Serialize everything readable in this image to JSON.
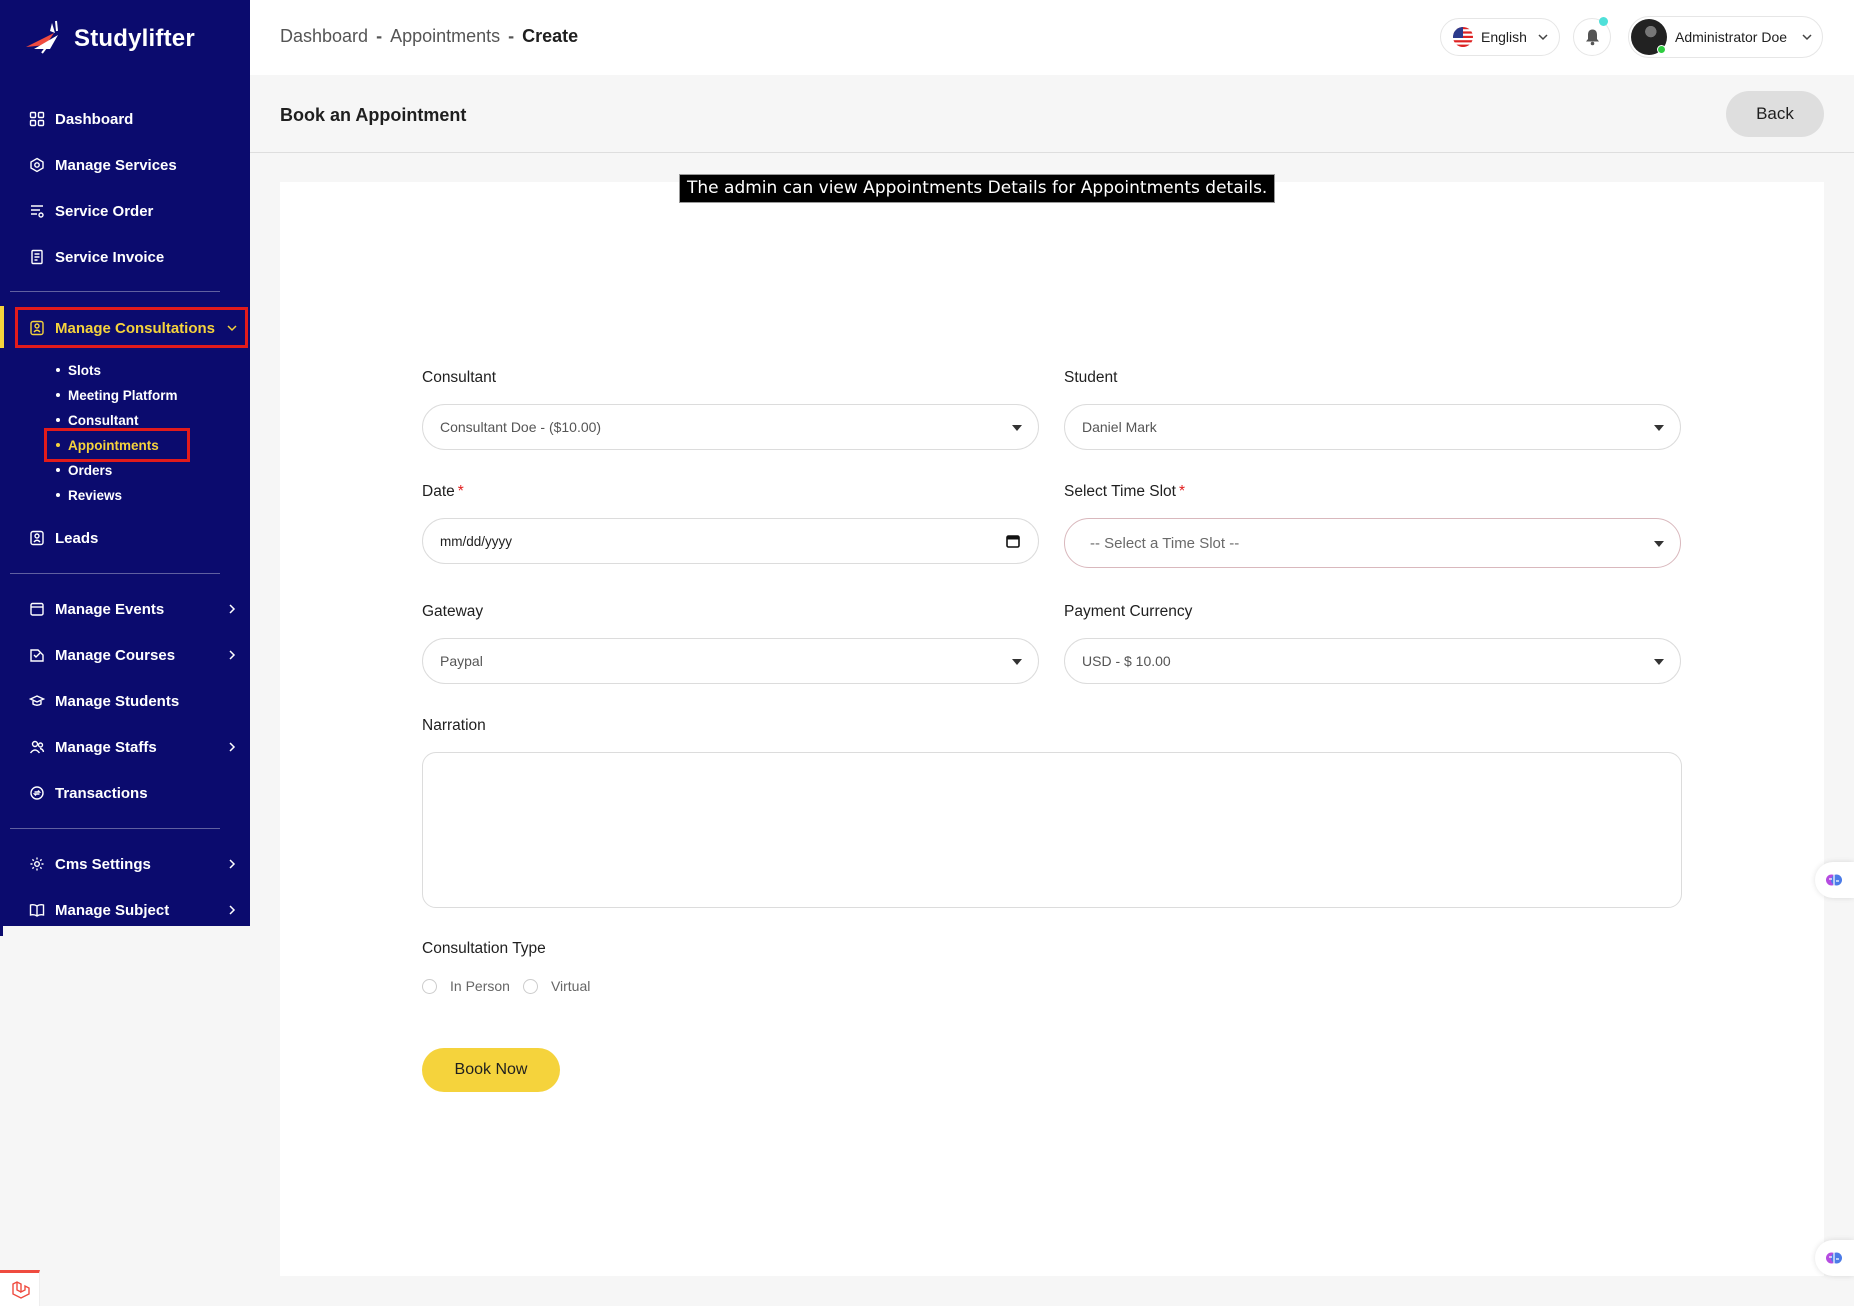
{
  "brand": {
    "name": "Studylifter"
  },
  "breadcrumb": {
    "items": [
      "Dashboard",
      "Appointments"
    ],
    "separator": "-",
    "current": "Create"
  },
  "topbar": {
    "language": "English",
    "user": "Administrator Doe",
    "colors": {
      "notification_badge": "#4fe0d9",
      "online": "#2ecc40"
    }
  },
  "sidebar": {
    "colors": {
      "background": "#0b0b6e",
      "active": "#f5d33c",
      "highlight_box": "#e11b1b"
    },
    "group1": [
      {
        "label": "Dashboard",
        "icon": "dashboard-icon"
      },
      {
        "label": "Manage Services",
        "icon": "services-icon"
      },
      {
        "label": "Service Order",
        "icon": "order-icon"
      },
      {
        "label": "Service Invoice",
        "icon": "invoice-icon"
      }
    ],
    "consultations": {
      "label": "Manage Consultations",
      "icon": "consultation-icon",
      "submenu": [
        "Slots",
        "Meeting Platform",
        "Consultant",
        "Appointments",
        "Orders",
        "Reviews"
      ],
      "active_submenu": "Appointments"
    },
    "leads": {
      "label": "Leads",
      "icon": "leads-icon"
    },
    "group2": [
      {
        "label": "Manage Events",
        "icon": "calendar-icon"
      },
      {
        "label": "Manage Courses",
        "icon": "courses-icon"
      },
      {
        "label": "Manage Students",
        "icon": "students-icon"
      },
      {
        "label": "Manage Staffs",
        "icon": "staff-icon"
      },
      {
        "label": "Transactions",
        "icon": "transactions-icon"
      }
    ],
    "group3": [
      {
        "label": "Cms Settings",
        "icon": "gear-icon"
      },
      {
        "label": "Manage Subject",
        "icon": "book-icon"
      }
    ]
  },
  "page": {
    "title": "Book an Appointment",
    "back_label": "Back"
  },
  "tooltip": "The admin can view Appointments Details for Appointments details.",
  "form": {
    "consultant": {
      "label": "Consultant",
      "value": "Consultant Doe - ($10.00)"
    },
    "student": {
      "label": "Student",
      "value": "Daniel Mark"
    },
    "date": {
      "label": "Date",
      "required": "*",
      "placeholder": "mm/dd/yyyy"
    },
    "time_slot": {
      "label": "Select Time Slot",
      "required": "*",
      "value": "-- Select a Time Slot --"
    },
    "gateway": {
      "label": "Gateway",
      "value": "Paypal"
    },
    "currency": {
      "label": "Payment Currency",
      "value": "USD - $ 10.00"
    },
    "narration": {
      "label": "Narration",
      "value": ""
    },
    "consultation_type": {
      "label": "Consultation Type",
      "options": [
        "In Person",
        "Virtual"
      ]
    },
    "submit_label": "Book Now"
  }
}
